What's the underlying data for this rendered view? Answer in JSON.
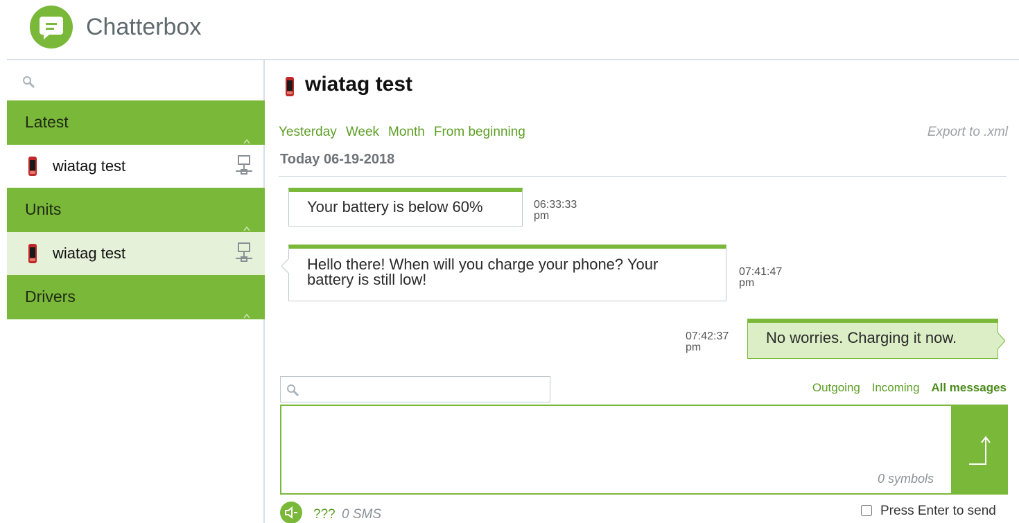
{
  "app": {
    "title": "Chatterbox"
  },
  "sidebar": {
    "search_placeholder": "",
    "sections": [
      {
        "label": "Latest",
        "items": [
          {
            "name": "wiatag test",
            "selected": false
          }
        ]
      },
      {
        "label": "Units",
        "items": [
          {
            "name": "wiatag test",
            "selected": true
          }
        ]
      },
      {
        "label": "Drivers",
        "items": []
      }
    ]
  },
  "chat": {
    "title": "wiatag test",
    "filters": [
      "Yesterday",
      "Week",
      "Month",
      "From beginning"
    ],
    "export_label": "Export to .xml",
    "date_label": "Today 06-19-2018",
    "messages": [
      {
        "direction": "incoming",
        "text": "Your battery is below 60%",
        "time": "06:33:33",
        "ampm": "pm"
      },
      {
        "direction": "incoming",
        "text": "Hello there! When will you charge your phone? Your battery is still low!",
        "time": "07:41:47",
        "ampm": "pm"
      },
      {
        "direction": "outgoing",
        "text": "No worries. Charging it now.",
        "time": "07:42:37",
        "ampm": "pm"
      }
    ]
  },
  "composer": {
    "search_placeholder": "",
    "message_filters": [
      "Outgoing",
      "Incoming",
      "All messages"
    ],
    "active_filter": "All messages",
    "message_value": "",
    "symbol_count": "0 symbols",
    "sms_unknown": "???",
    "sms_count": "0 SMS",
    "press_enter_label": "Press Enter to send",
    "press_enter_checked": false
  },
  "colors": {
    "accent": "#7ab83a",
    "link": "#5d9e25",
    "selected_bg": "#e6f1d9",
    "outgoing_bg": "#dbeec5"
  },
  "icons": {
    "logo": "chat-bubble-icon",
    "unit": "phone-icon",
    "network": "network-icon",
    "search": "search-icon",
    "send": "send-arrow-icon",
    "speaker": "speaker-icon",
    "chevron": "chevron-up-icon"
  }
}
